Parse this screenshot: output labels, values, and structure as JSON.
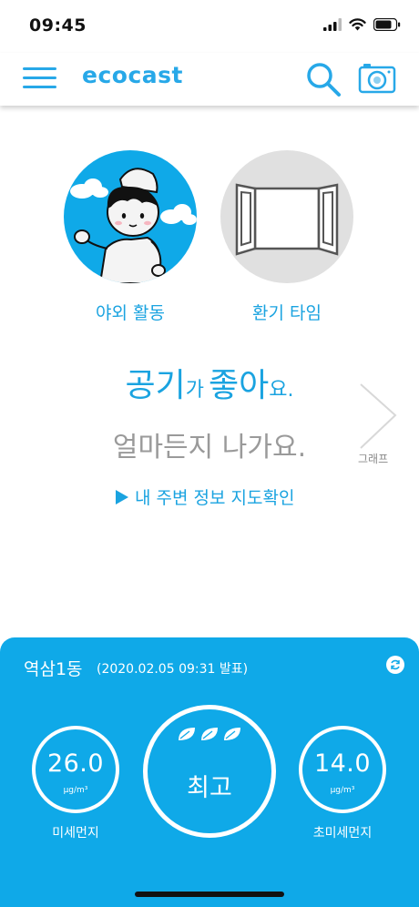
{
  "status_bar": {
    "time": "09:45",
    "icons": [
      "signal-icon",
      "wifi-icon",
      "battery-icon"
    ]
  },
  "navbar": {
    "logo": "ecocast",
    "icons": [
      "menu-icon",
      "search-icon",
      "camera-icon"
    ]
  },
  "activities": {
    "outdoor_label": "야외 활동",
    "vent_label": "환기 타임"
  },
  "message": {
    "word1": "공기",
    "particle1": "가",
    "word2": "좋아",
    "particle2": "요.",
    "sub": "얼마든지 나가요.",
    "map_link": "내 주변 정보 지도확인",
    "graph_label": "그래프"
  },
  "air_panel": {
    "location": "역삼1동",
    "published": "(2020.02.05 09:31 발표)",
    "pm10": {
      "value": "26.0",
      "unit": "μg/m³",
      "label": "미세먼지"
    },
    "grade": "최고",
    "pm25": {
      "value": "14.0",
      "unit": "μg/m³",
      "label": "초미세먼지"
    }
  },
  "colors": {
    "accent": "#1aa3e0",
    "panel_bg": "#0fa9e8"
  }
}
